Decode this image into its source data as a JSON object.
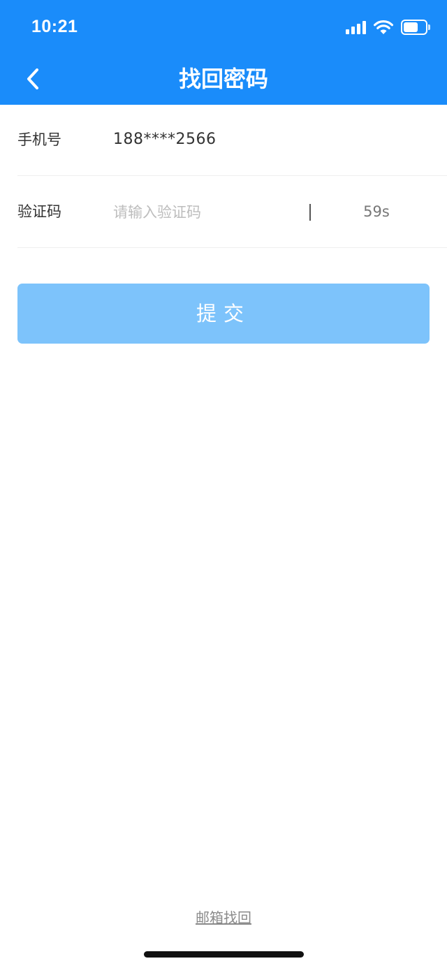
{
  "status_bar": {
    "time": "10:21",
    "icons": [
      "signal-icon",
      "wifi-icon",
      "battery-icon"
    ]
  },
  "nav": {
    "title": "找回密码",
    "back_icon": "chevron-left-icon"
  },
  "form": {
    "phone_label": "手机号",
    "phone_value": "188****2566",
    "code_label": "验证码",
    "code_value": "",
    "code_placeholder": "请输入验证码",
    "countdown": "59s"
  },
  "submit_label": "提交",
  "email_recovery_link": "邮箱找回",
  "colors": {
    "primary": "#1A8CFA",
    "submit_disabled": "#7DC3FB",
    "label_text": "#333333",
    "placeholder": "#BDBDBD",
    "link": "#8A8A8A"
  }
}
